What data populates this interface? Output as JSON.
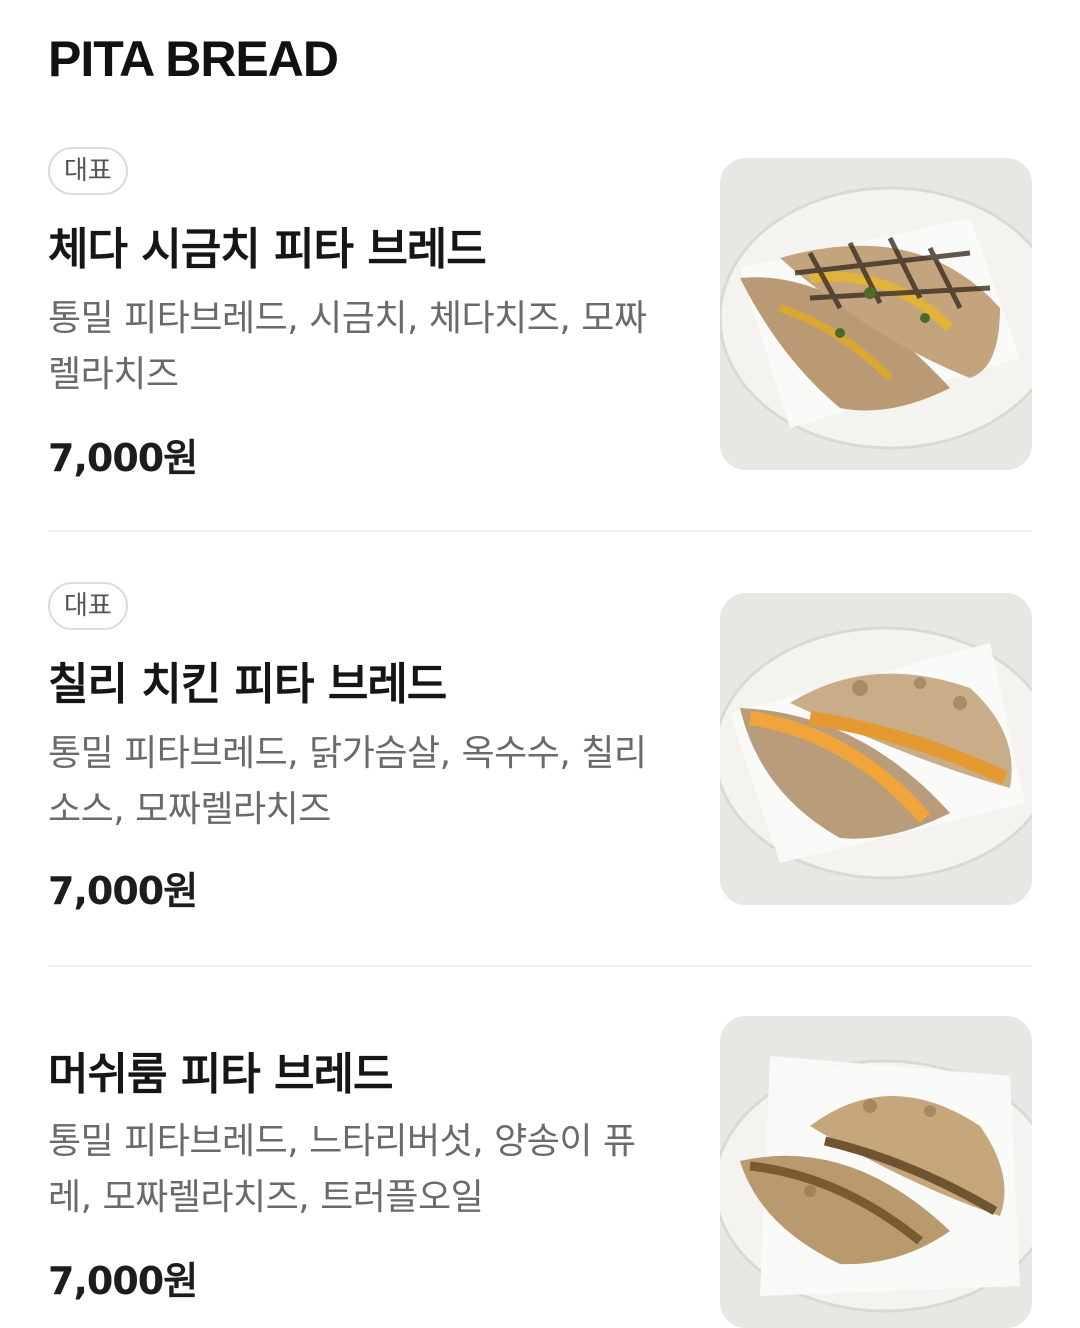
{
  "section_title": "PITA BREAD",
  "items": [
    {
      "badge": "대표",
      "name": "체다 시금치 피타 브레드",
      "description": "통밀 피타브레드, 시금치, 체다치즈, 모짜렐라치즈",
      "price": "7,000원",
      "image_icon": "cheddar-spinach-pita-photo"
    },
    {
      "badge": "대표",
      "name": "칠리 치킨 피타 브레드",
      "description": "통밀 피타브레드, 닭가슴살, 옥수수, 칠리소스, 모짜렐라치즈",
      "price": "7,000원",
      "image_icon": "chili-chicken-pita-photo"
    },
    {
      "name": "머쉬룸 피타 브레드",
      "description": "통밀 피타브레드, 느타리버섯, 양송이 퓨레, 모짜렐라치즈, 트러플오일",
      "price": "7,000원",
      "image_icon": "mushroom-pita-photo"
    }
  ]
}
